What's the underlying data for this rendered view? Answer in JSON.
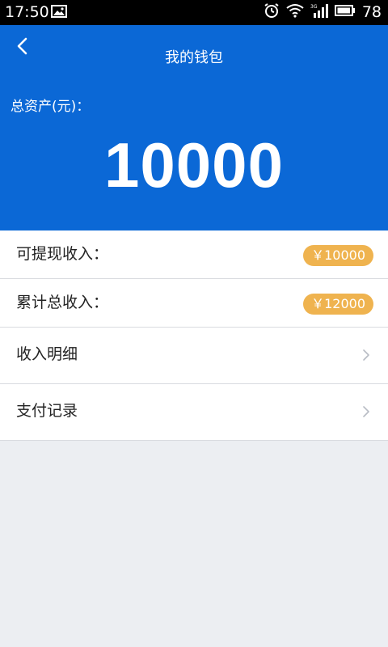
{
  "status_bar": {
    "time": "17:50",
    "battery": "78",
    "icons": [
      "image-icon",
      "alarm-icon",
      "wifi-icon",
      "signal-3g-icon",
      "battery-icon"
    ]
  },
  "header": {
    "title": "我的钱包",
    "assets_label": "总资产(元)：",
    "assets_value": "10000",
    "background_color": "#0b68d6"
  },
  "list": {
    "withdrawable": {
      "label": "可提现收入：",
      "amount": "￥10000"
    },
    "cumulative": {
      "label": "累计总收入：",
      "amount": "￥12000"
    },
    "income_details": {
      "label": "收入明细"
    },
    "payment_records": {
      "label": "支付记录"
    },
    "badge_color": "#efb34f"
  }
}
